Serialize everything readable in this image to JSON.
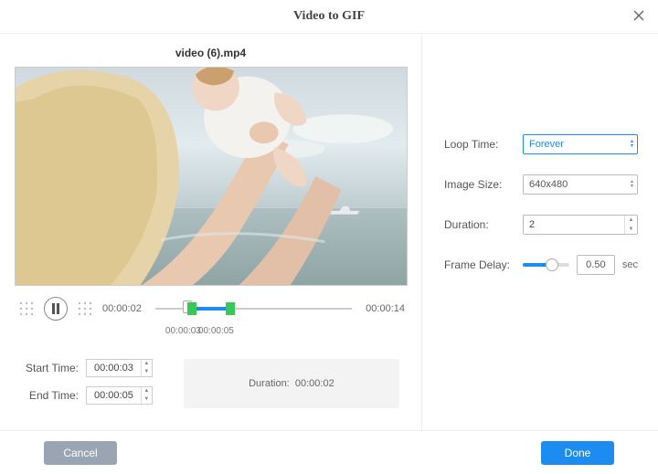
{
  "title": "Video to GIF",
  "filename": "video (6).mp4",
  "playback": {
    "current_time": "00:00:02",
    "total_time": "00:00:14",
    "playhead_pct": 14,
    "sel_start_pct": 21,
    "sel_end_pct": 36,
    "sel_start_label": "00:00:03",
    "sel_end_label": "00:00:05"
  },
  "times": {
    "start_label": "Start Time:",
    "start_value": "00:00:03",
    "end_label": "End Time:",
    "end_value": "00:00:05",
    "duration_prefix": "Duration:",
    "duration_value": "00:00:02"
  },
  "settings": {
    "loop_label": "Loop Time:",
    "loop_value": "Forever",
    "size_label": "Image Size:",
    "size_value": "640x480",
    "duration_label": "Duration:",
    "duration_value": "2",
    "frame_label": "Frame Delay:",
    "frame_value": "0.50",
    "frame_unit": "sec",
    "frame_slider_pct": 62
  },
  "footer": {
    "cancel": "Cancel",
    "done": "Done"
  }
}
